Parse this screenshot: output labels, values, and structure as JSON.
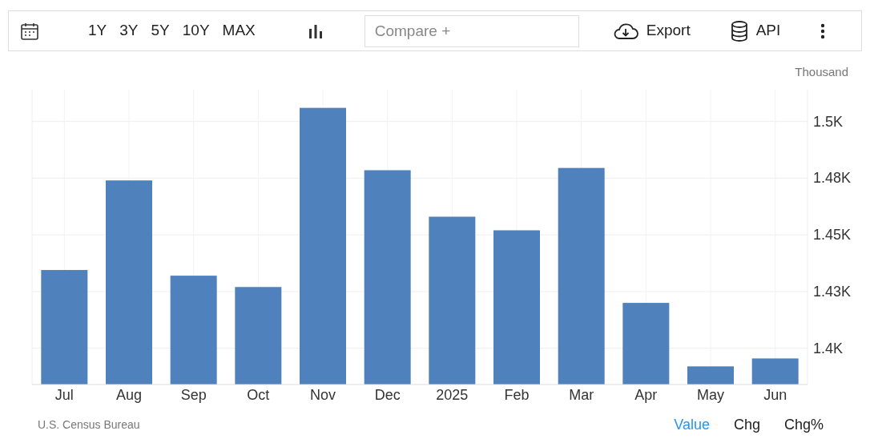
{
  "toolbar": {
    "ranges": [
      {
        "label": "1Y"
      },
      {
        "label": "3Y"
      },
      {
        "label": "5Y"
      },
      {
        "label": "10Y"
      },
      {
        "label": "MAX"
      }
    ],
    "compare": {
      "placeholder": "Compare +"
    },
    "export": "Export",
    "api": "API"
  },
  "unit": "Thousand",
  "chart_data": {
    "type": "bar",
    "categories": [
      "Jul",
      "Aug",
      "Sep",
      "Oct",
      "Nov",
      "Dec",
      "2025",
      "Feb",
      "Mar",
      "Apr",
      "May",
      "Jun"
    ],
    "series": [
      {
        "color": "#4f81bd",
        "values": [
          1434.5,
          1474,
          1432,
          1427,
          1506,
          1478.5,
          1458,
          1452,
          1479.5,
          1420,
          1392,
          1395.5
        ]
      }
    ],
    "ylim": [
      1384,
      1514
    ],
    "grid": true,
    "yticks": [
      {
        "value": 1400,
        "label": "1.4K"
      },
      {
        "value": 1425,
        "label": "1.43K"
      },
      {
        "value": 1450,
        "label": "1.45K"
      },
      {
        "value": 1475,
        "label": "1.48K"
      },
      {
        "value": 1500,
        "label": "1.5K"
      }
    ]
  },
  "source": "U.S. Census Bureau",
  "views": [
    {
      "label": "Value",
      "selected": true
    },
    {
      "label": "Chg",
      "selected": false
    },
    {
      "label": "Chg%",
      "selected": false
    }
  ]
}
